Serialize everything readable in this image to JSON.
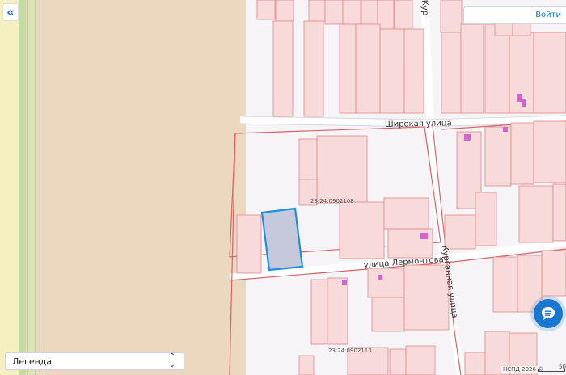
{
  "header": {
    "collapse_icon": "double-chevron-left-icon",
    "login_label": "Войти"
  },
  "map": {
    "streets": {
      "shirokaya": "Широкая  улица",
      "lermontova": "улица  Лермонтова",
      "kurgannaya": "Курганная  улица",
      "kurgannaya_top": "Кур"
    },
    "cadastral_quarters": [
      "23:24:0902108",
      "23:24:0902113"
    ],
    "selected_parcel_color": "#1f8fe0",
    "parcel_border_color": "#d98a8a",
    "parcel_fill_color": "#f8dada",
    "building_color": "#d564d0"
  },
  "legend": {
    "label": "Легенда",
    "chevron_icon": "chevron-up-down-icon"
  },
  "chat": {
    "icon": "chat-bubble-icon"
  },
  "attribution": {
    "text": "НСПД 2026 ©"
  },
  "scale": {
    "label": "50"
  }
}
